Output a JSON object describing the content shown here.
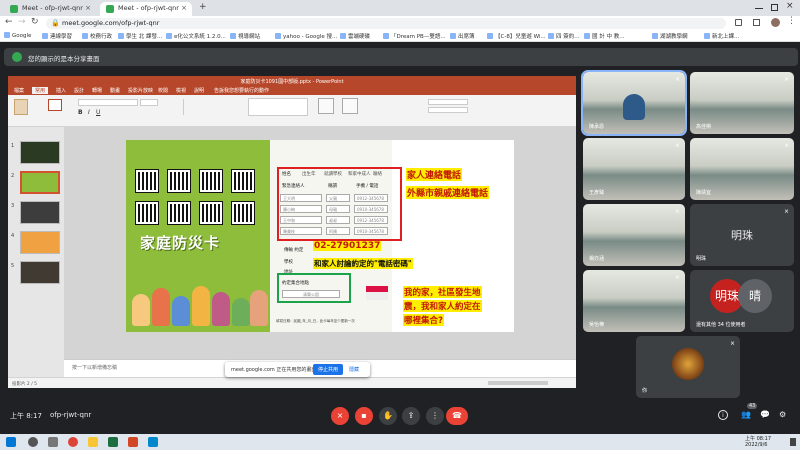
{
  "browser": {
    "tabs": [
      {
        "title": "Meet - ofp-rjwt-qnr",
        "close": "×"
      },
      {
        "title": "Meet - ofp-rjwt-qnr",
        "close": "×"
      }
    ],
    "new_tab": "+",
    "url": "meet.google.com/ofp-rjwt-qnr",
    "bookmarks": [
      "Google",
      "連線學習",
      "校務行政",
      "學生 北 課發...",
      "e化公文系統 1.2.0...",
      "視導網站",
      "yahoo - Google 搜...",
      "雲端硬碟",
      "「Dream PB—雙語...",
      "出席簿",
      "【C-8】兒童遊 Wi...",
      "四 簽約...",
      "國 計 中 教...",
      "湖湖教學網",
      "新北上課..."
    ]
  },
  "meet": {
    "banner": "您的顯示的是本分享畫面",
    "meeting_code": "ofp-rjwt-qnr",
    "time": "上午 8:17",
    "participant_count": "43",
    "participants": [
      {
        "name": "陳承恩"
      },
      {
        "name": "高佳棋"
      },
      {
        "name": "王彥臻"
      },
      {
        "name": "陳靖宜"
      },
      {
        "name": "楊亦涵"
      },
      {
        "name": "明珠",
        "initial": "明珠"
      },
      {
        "name": "吳怡樺"
      },
      {
        "name": "還有其他 34 位使用者",
        "initials": [
          "明珠",
          "晴"
        ]
      },
      {
        "name": "你"
      }
    ]
  },
  "ppt": {
    "title_bar": "家庭防災卡1091國中部版.pptx - PowerPoint",
    "tabs": [
      "檔案",
      "常用",
      "插入",
      "設計",
      "轉場",
      "動畫",
      "投影片放映",
      "校閱",
      "檢視",
      "說明",
      "告訴我您想要執行的動作"
    ],
    "notes_placeholder": "按一下以新增備忘稿",
    "status": "投影片 2 / 5",
    "slide_numbers": [
      "1",
      "2",
      "3",
      "4",
      "5"
    ],
    "card": {
      "title": "家庭防災卡",
      "table_headers": [
        "姓名",
        "出生年",
        "就讀學校",
        "和家中成人",
        "聯絡"
      ],
      "contact_header": [
        "緊急連絡人",
        "稱謂",
        "手機 / 電話"
      ],
      "rows": [
        [
          "王大明",
          "父親",
          "0912-345678"
        ],
        [
          "陳小梅",
          "母親",
          "0910-345678"
        ],
        [
          "王中和",
          "叔叔",
          "0912-345678"
        ],
        [
          "陳美枝",
          "阿姨",
          "0910-345678"
        ]
      ],
      "fields": [
        "傳輸 約定",
        "學校",
        "地址"
      ],
      "meeting_label": "約定集合地點",
      "meeting_place": "清樂公園",
      "note": "填寫日期：民國_年_月_日，此卡每年至少更新一次"
    },
    "annotations": {
      "family_contact": "家人連絡電話",
      "relative_contact": "外縣市親戚連絡電話",
      "phone": "02-27901237",
      "password_line": "和家人討論約定的\"電話密碼\"",
      "meeting_q1": "我的家，社區發生地",
      "meeting_q2": "震，我和家人約定在",
      "meeting_q3": "哪裡集合?"
    }
  },
  "share_prompt": {
    "text": "meet.google.com 正在共用您的畫面。",
    "stop": "停止共用",
    "hide": "隱藏"
  },
  "taskbar": {
    "time": "上午 08:17",
    "date": "2022/9/6"
  },
  "colors": {
    "ppt_red": "#b7472a",
    "card_green": "#8ebd3b",
    "annotation_yellow": "#ffee00",
    "annotation_red": "#c21807",
    "end_call_red": "#ea4335"
  }
}
